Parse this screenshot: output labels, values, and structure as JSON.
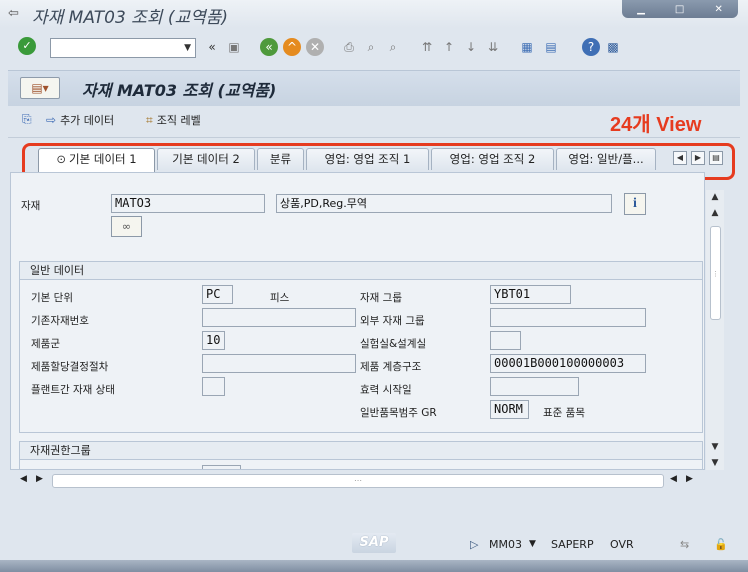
{
  "window": {
    "title": "자재 MAT03 조회 (교역품)"
  },
  "header": {
    "title": "자재 MAT03 조회 (교역품)"
  },
  "app_toolbar": {
    "additional_data": "추가 데이터",
    "org_levels": "조직 레벨"
  },
  "annotation": "24개 View",
  "tabs": [
    {
      "label": "기본 데이터 1",
      "active": true
    },
    {
      "label": "기본 데이터 2"
    },
    {
      "label": "분류"
    },
    {
      "label": "영업: 영업 조직 1"
    },
    {
      "label": "영업: 영업 조직 2"
    },
    {
      "label": "영업: 일반/플..."
    }
  ],
  "material": {
    "label": "자재",
    "value": "MATO3",
    "description": "상품,PD,Reg.무역"
  },
  "general": {
    "title": "일반 데이터",
    "base_unit_label": "기본 단위",
    "base_unit_value": "PC",
    "base_unit_text": "피스",
    "material_group_label": "자재 그룹",
    "material_group_value": "YBT01",
    "old_material_label": "기존자재번호",
    "old_material_value": "",
    "ext_material_group_label": "외부 자재 그룹",
    "ext_material_group_value": "",
    "division_label": "제품군",
    "division_value": "10",
    "lab_office_label": "실험실&설계실",
    "lab_office_value": "",
    "allocation_label": "제품할당결정절차",
    "allocation_value": "",
    "product_hierarchy_label": "제품 계층구조",
    "product_hierarchy_value": "00001B000100000003",
    "xplant_status_label": "플랜트간 자재 상태",
    "xplant_status_value": "",
    "valid_from_label": "효력 시작일",
    "valid_from_value": "",
    "item_cat_group_label": "일반품목범주 GR",
    "item_cat_group_value": "NORM",
    "item_cat_group_text": "표준 품목"
  },
  "authorization": {
    "title": "자재권한그룹"
  },
  "status_bar": {
    "tcode": "MM03",
    "system": "SAPERP",
    "mode": "OVR",
    "logo": "SAP"
  }
}
